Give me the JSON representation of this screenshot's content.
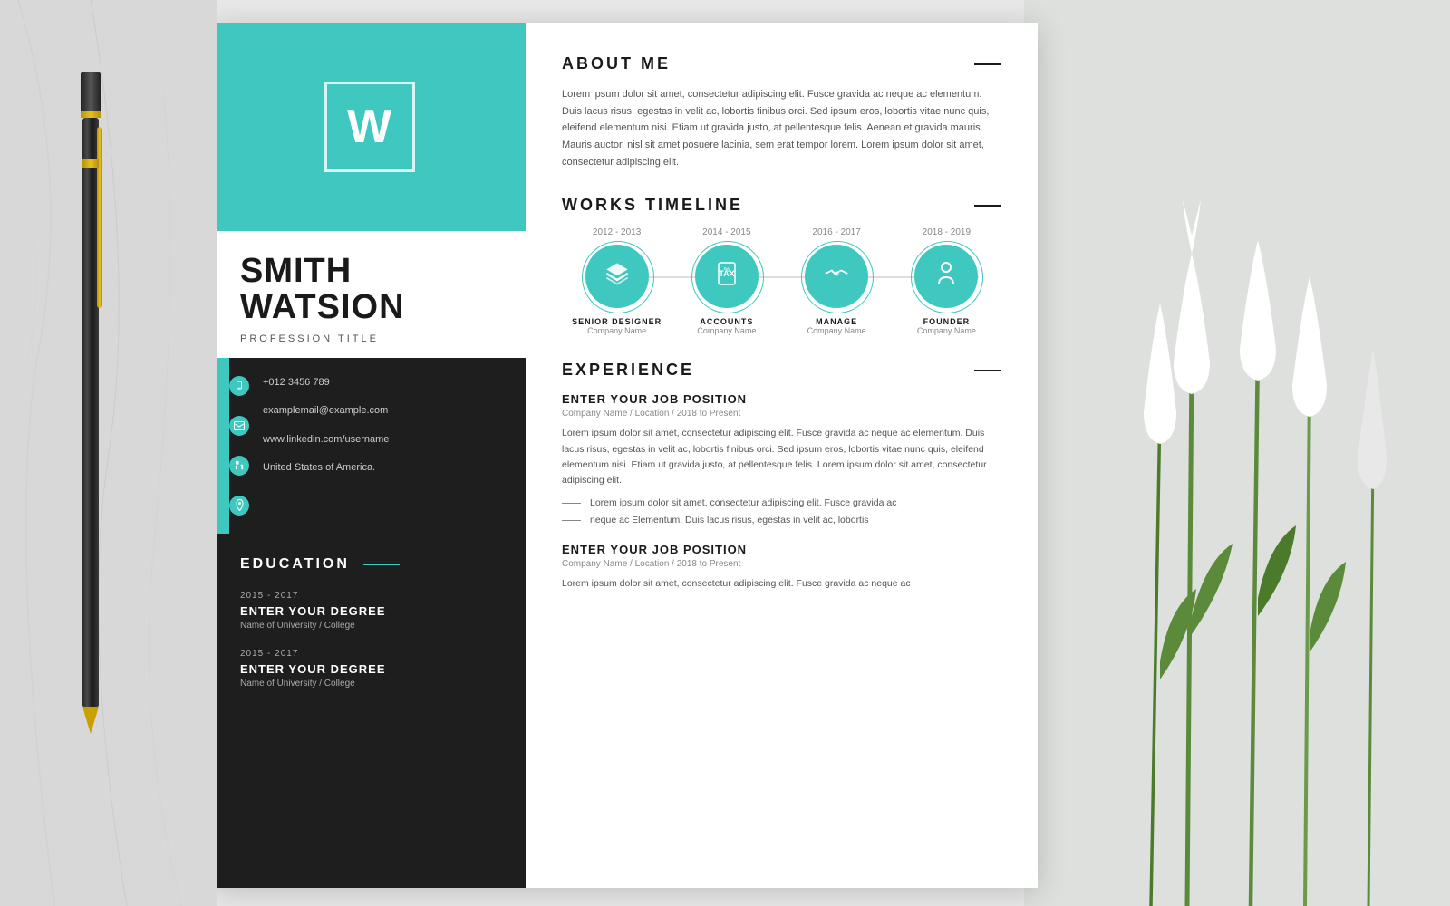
{
  "background": {
    "left_color": "#d8d8d8",
    "right_color": "#d8d8d8"
  },
  "resume": {
    "logo": {
      "letter": "W"
    },
    "name": {
      "first": "SMITH",
      "last": "WATSION",
      "profession": "PROFESSION TITLE"
    },
    "contact": {
      "phone": "+012 3456 789",
      "email": "examplemail@example.com",
      "linkedin": "www.linkedin.com/username",
      "address": "United States of America."
    },
    "education": {
      "title": "EDUCATION",
      "items": [
        {
          "years": "2015 - 2017",
          "degree": "ENTER YOUR DEGREE",
          "university": "Name of University / College"
        },
        {
          "years": "2015 - 2017",
          "degree": "ENTER YOUR DEGREE",
          "university": "Name of University / College"
        }
      ]
    },
    "about": {
      "title": "ABOUT ME",
      "text": "Lorem ipsum dolor sit amet, consectetur adipiscing elit. Fusce gravida ac neque ac elementum. Duis lacus risus, egestas in velit ac, lobortis finibus orci. Sed ipsum eros, lobortis vitae nunc quis, eleifend elementum nisi. Etiam ut gravida justo, at pellentesque felis. Aenean et gravida mauris. Mauris auctor, nisl sit amet posuere lacinia, sem erat tempor lorem. Lorem ipsum dolor sit amet, consectetur adipiscing elit."
    },
    "works_timeline": {
      "title": "WORKS TIMELINE",
      "items": [
        {
          "years": "2012 - 2013",
          "role": "SENIOR DESIGNER",
          "company": "Company Name",
          "icon": "layers"
        },
        {
          "years": "2014 - 2015",
          "role": "ACCOUNTS",
          "company": "Company Name",
          "icon": "tax"
        },
        {
          "years": "2016 - 2017",
          "role": "MANAGE",
          "company": "Company Name",
          "icon": "handshake"
        },
        {
          "years": "2018 - 2019",
          "role": "FOUNDER",
          "company": "Company Name",
          "icon": "person"
        }
      ]
    },
    "experience": {
      "title": "EXPERIENCE",
      "jobs": [
        {
          "title": "ENTER YOUR JOB POSITION",
          "meta": "Company Name / Location / 2018 to Present",
          "description": "Lorem ipsum dolor sit amet, consectetur adipiscing elit. Fusce gravida ac neque ac elementum. Duis lacus risus, egestas in velit ac, lobortis finibus orci. Sed ipsum eros, lobortis vitae nunc quis, eleifend elementum nisi. Etiam ut gravida justo, at pellentesque felis. Lorem ipsum dolor sit amet, consectetur adipiscing elit.",
          "bullets": [
            "Lorem ipsum dolor sit amet, consectetur adipiscing elit. Fusce gravida ac",
            "neque ac Elementum. Duis lacus risus, egestas in velit ac, lobortis"
          ]
        },
        {
          "title": "ENTER YOUR JOB POSITION",
          "meta": "Company Name / Location / 2018 to Present",
          "description": "Lorem ipsum dolor sit amet, consectetur adipiscing elit. Fusce gravida ac neque ac",
          "bullets": []
        }
      ]
    }
  }
}
